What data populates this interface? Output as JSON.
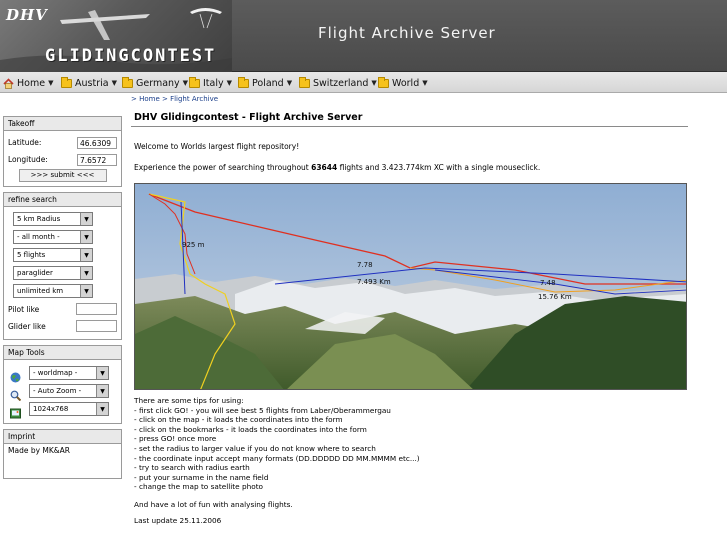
{
  "header": {
    "logo_dhv": "DHV",
    "logo_name": "GLIDINGCONTEST",
    "title": "Flight Archive Server"
  },
  "nav": {
    "items": [
      {
        "label": "Home",
        "icon": "home-icon"
      },
      {
        "label": "Austria",
        "icon": "folder-icon"
      },
      {
        "label": "Germany",
        "icon": "folder-icon"
      },
      {
        "label": "Italy",
        "icon": "folder-icon"
      },
      {
        "label": "Poland",
        "icon": "folder-icon"
      },
      {
        "label": "Switzerland",
        "icon": "folder-icon"
      },
      {
        "label": "World",
        "icon": "folder-icon"
      }
    ]
  },
  "breadcrumb": "> Home > Flight Archive",
  "takeoff": {
    "title": "Takeoff",
    "latitude_label": "Latitude:",
    "latitude_value": "46.6309",
    "longitude_label": "Longitude:",
    "longitude_value": "7.6572",
    "submit_label": ">>> submit <<<"
  },
  "refine": {
    "title": "refine search",
    "selects": [
      "5 km Radius",
      "- all month -",
      "5 flights",
      "paraglider",
      "unlimited km"
    ],
    "pilot_label": "Pilot like",
    "glider_label": "Glider like"
  },
  "map_tools": {
    "title": "Map Tools",
    "rows": [
      {
        "icon": "globe-icon",
        "value": "- worldmap -"
      },
      {
        "icon": "magnifier-icon",
        "value": "- Auto Zoom -"
      },
      {
        "icon": "screen-size-icon",
        "value": "1024x768"
      }
    ]
  },
  "imprint": {
    "title": "Imprint",
    "text": "Made by MK&AR"
  },
  "main": {
    "title": "DHV Glidingcontest  -  Flight Archive Server",
    "welcome": "Welcome to Worlds largest flight repository!",
    "intro_pre": "Experience the power of searching throughout ",
    "intro_count": "63644",
    "intro_post": " flights and 3.423.774km XC with a single mouseclick.",
    "picture_labels": [
      "925 m",
      "7.78",
      "7.493 Km",
      "7.48",
      "15.76 Km"
    ],
    "tips_title": "There are some tips for using:",
    "tips": [
      "- first click GO! - you will see best 5 flights from Laber/Oberammergau",
      "- click on the map - it loads the coordinates into the form",
      "- click on the bookmarks - it loads the coordinates into the form",
      "- press GO! once more",
      "- set the radius to larger value if you do not know where to search",
      "- the coordinate input accept many formats (DD.DDDDD DD MM.MMMM etc...)",
      "- try to search with radius earth",
      "- put your surname in the name field",
      "- change the map to satellite photo"
    ],
    "fun": "And have a lot of fun with analysing flights.",
    "last_update": "Last update 25.11.2006"
  },
  "colors": {
    "header_bg": "#4f4f4f",
    "link_blue": "#1a3e8a",
    "track_red": "#e03020",
    "track_yellow": "#f0d020",
    "track_blue": "#2030c0",
    "sky": "#a9bfd9"
  }
}
